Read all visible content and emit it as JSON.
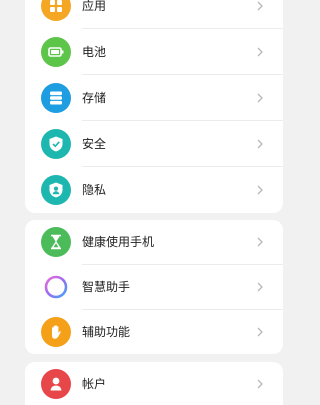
{
  "settings": {
    "group1": [
      {
        "id": "apps",
        "label": "应用",
        "icon": "apps-grid-icon",
        "color": "#f5a623"
      },
      {
        "id": "battery",
        "label": "电池",
        "icon": "battery-icon",
        "color": "#5cc54a"
      },
      {
        "id": "storage",
        "label": "存储",
        "icon": "storage-icon",
        "color": "#1e9de0"
      },
      {
        "id": "security",
        "label": "安全",
        "icon": "shield-icon",
        "color": "#1db7b0"
      },
      {
        "id": "privacy",
        "label": "隐私",
        "icon": "privacy-icon",
        "color": "#1db7b0"
      }
    ],
    "group2": [
      {
        "id": "digital-balance",
        "label": "健康使用手机",
        "icon": "hourglass-icon",
        "color": "#4cbb5a"
      },
      {
        "id": "assistant",
        "label": "智慧助手",
        "icon": "assistant-ring-icon",
        "color": "#9b6bf0"
      },
      {
        "id": "accessibility",
        "label": "辅助功能",
        "icon": "hand-icon",
        "color": "#f5a019"
      }
    ],
    "group3": [
      {
        "id": "account",
        "label": "帐户",
        "icon": "user-icon",
        "color": "#e8474a"
      }
    ]
  }
}
